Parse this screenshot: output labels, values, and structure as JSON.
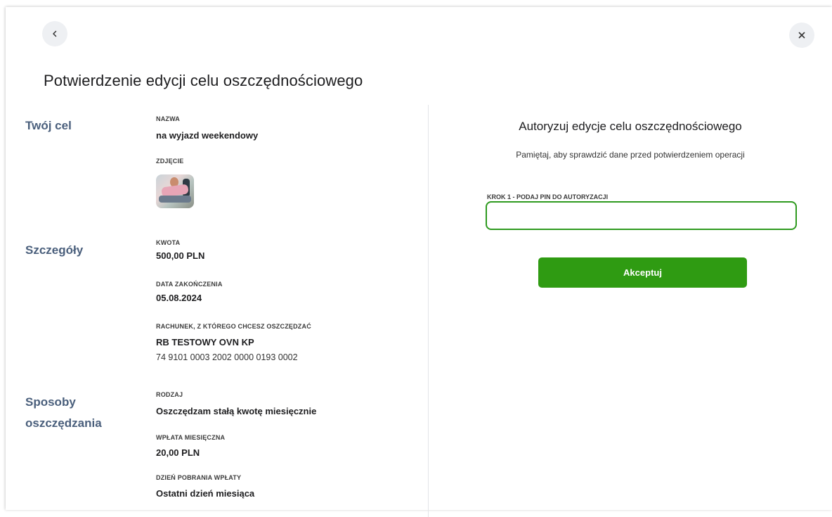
{
  "header": {
    "back_icon": "chevron-left-icon",
    "close_icon": "close-icon",
    "title": "Potwierdzenie edycji celu oszczędnościowego"
  },
  "summary": {
    "goal": {
      "section_title": "Twój cel",
      "name_label": "NAZWA",
      "name_value": "na wyjazd weekendowy",
      "photo_label": "ZDJĘCIE"
    },
    "details": {
      "section_title": "Szczegóły",
      "amount_label": "KWOTA",
      "amount_value": "500,00 PLN",
      "end_date_label": "DATA ZAKOŃCZENIA",
      "end_date_value": "05.08.2024",
      "account_label": "RACHUNEK, Z KTÓREGO CHCESZ OSZCZĘDZAĆ",
      "account_name": "RB TESTOWY OVN KP",
      "account_number": "74 9101 0003 2002 0000 0193 0002"
    },
    "methods": {
      "section_title": "Sposoby oszczędzania",
      "type_label": "RODZAJ",
      "type_value": "Oszczędzam stałą kwotę miesięcznie",
      "monthly_label": "WPŁATA MIESIĘCZNA",
      "monthly_value": "20,00 PLN",
      "day_label": "DZIEŃ POBRANIA WPŁATY",
      "day_value": "Ostatni dzień miesiąca"
    }
  },
  "authorization": {
    "title": "Autoryzuj edycje celu oszczędnościowego",
    "subtitle": "Pamiętaj, aby sprawdzić dane przed potwierdzeniem operacji",
    "pin_label": "KROK 1 - PODAJ PIN DO AUTORYZACJI",
    "pin_value": "",
    "accept_label": "Akceptuj"
  },
  "colors": {
    "accent_green": "#2f9b12",
    "section_title": "#4a5f7c",
    "input_border": "#2e9a1f"
  }
}
